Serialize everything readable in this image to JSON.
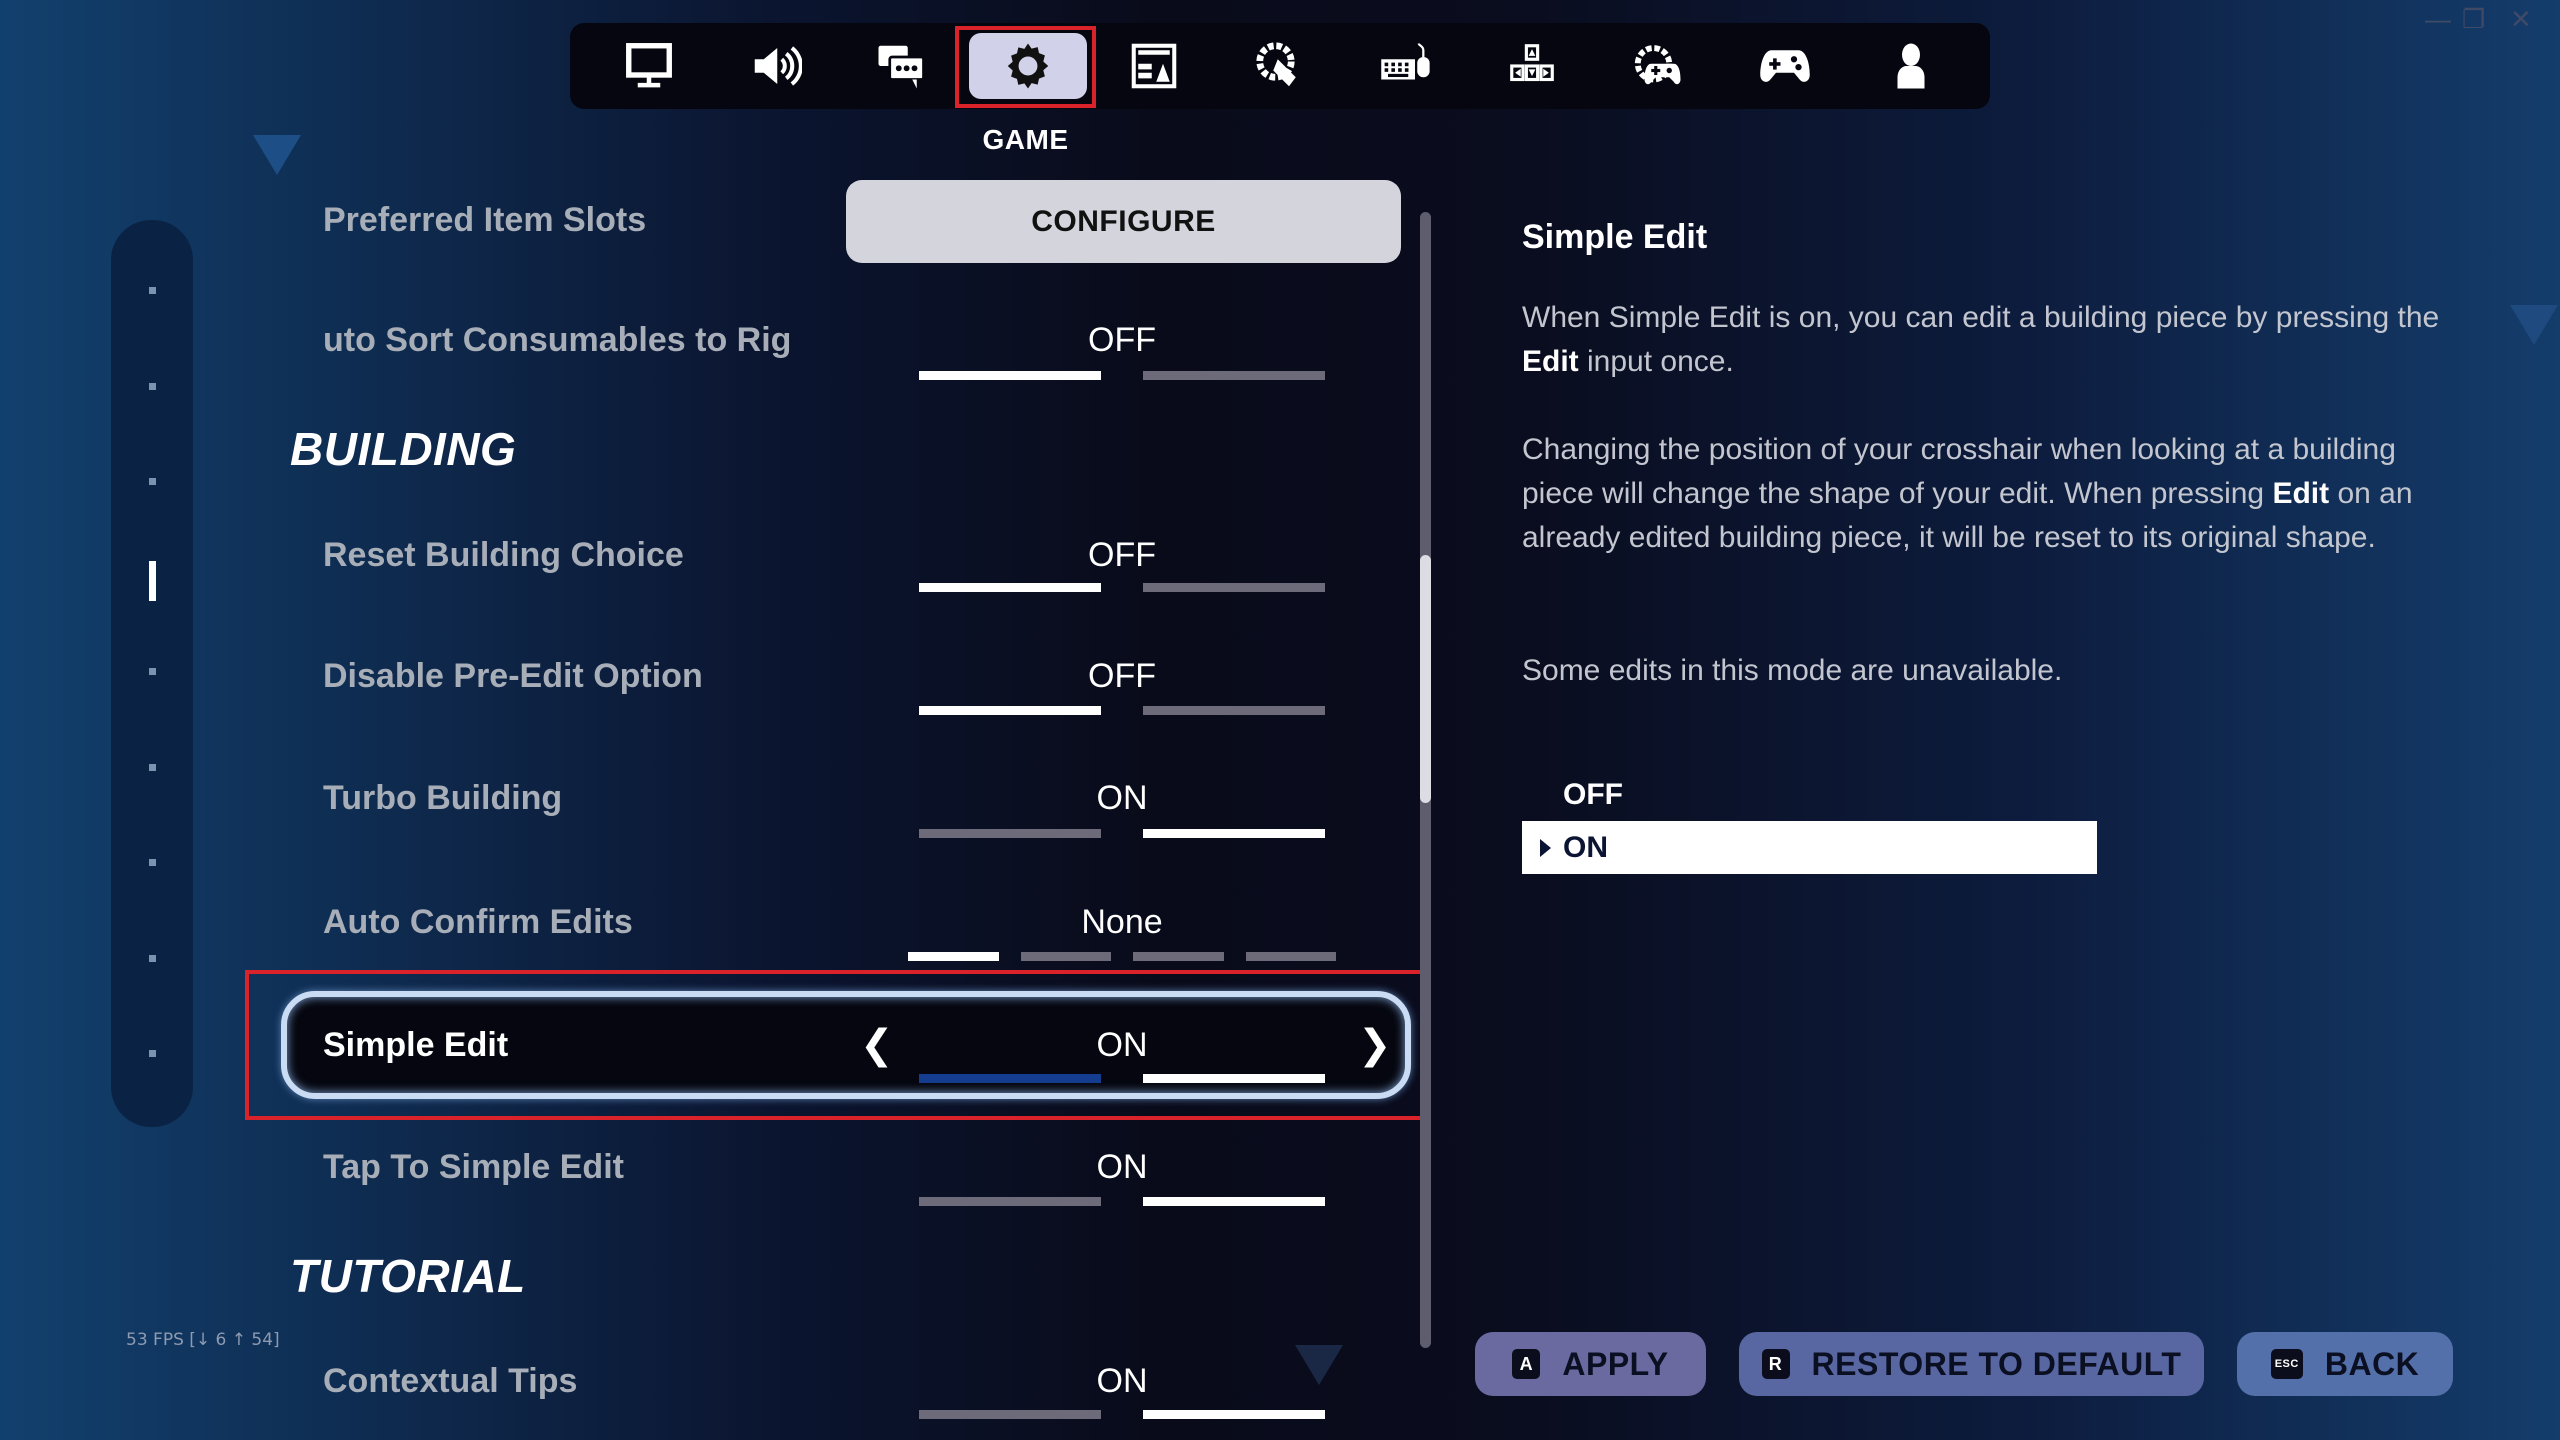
{
  "window_controls": {
    "minimize": "—",
    "restore": "❐",
    "close": "✕"
  },
  "tabs": [
    {
      "name": "display",
      "icon": "monitor-icon",
      "active": false
    },
    {
      "name": "audio",
      "icon": "speaker-icon",
      "active": false
    },
    {
      "name": "social",
      "icon": "chat-bubbles-icon",
      "active": false
    },
    {
      "name": "game",
      "icon": "gear-icon",
      "active": true
    },
    {
      "name": "ui",
      "icon": "layout-icon",
      "active": false
    },
    {
      "name": "touch",
      "icon": "gear-touch-icon",
      "active": false
    },
    {
      "name": "keyboard-mouse",
      "icon": "keyboard-mouse-icon",
      "active": false
    },
    {
      "name": "keybinds",
      "icon": "arrow-keys-icon",
      "active": false
    },
    {
      "name": "controller-settings",
      "icon": "gear-controller-icon",
      "active": false
    },
    {
      "name": "controller",
      "icon": "gamepad-icon",
      "active": false
    },
    {
      "name": "account",
      "icon": "user-icon",
      "active": false
    }
  ],
  "active_tab_label": "GAME",
  "scroll_progress_marker": 4,
  "rows": {
    "preferred_item_slots": {
      "label": "Preferred Item Slots",
      "button": "CONFIGURE"
    },
    "auto_sort": {
      "label": "uto Sort Consumables to Rig",
      "value": "OFF",
      "options": [
        "OFF",
        "ON"
      ],
      "selected_index": 0
    },
    "section_building": "BUILDING",
    "reset_building_choice": {
      "label": "Reset Building Choice",
      "value": "OFF",
      "options": [
        "OFF",
        "ON"
      ],
      "selected_index": 0
    },
    "disable_pre_edit": {
      "label": "Disable Pre-Edit Option",
      "value": "OFF",
      "options": [
        "OFF",
        "ON"
      ],
      "selected_index": 0
    },
    "turbo_building": {
      "label": "Turbo Building",
      "value": "ON",
      "options": [
        "OFF",
        "ON"
      ],
      "selected_index": 1
    },
    "auto_confirm_edits": {
      "label": "Auto Confirm Edits",
      "value": "None",
      "option_count": 4,
      "selected_index": 0
    },
    "simple_edit": {
      "label": "Simple Edit",
      "value": "ON",
      "options": [
        "OFF",
        "ON"
      ],
      "selected_index": 1,
      "prev_arrow": "❮",
      "next_arrow": "❯"
    },
    "tap_to_simple_edit": {
      "label": "Tap To Simple Edit",
      "value": "ON",
      "options": [
        "OFF",
        "ON"
      ],
      "selected_index": 1
    },
    "section_tutorial": "TUTORIAL",
    "contextual_tips": {
      "label": "Contextual Tips",
      "value": "ON",
      "options": [
        "OFF",
        "ON"
      ],
      "selected_index": 1
    }
  },
  "fps_overlay": "53 FPS [↓ 6 ↑ 54]",
  "description": {
    "title": "Simple Edit",
    "p1_a": "When Simple Edit is on, you can edit a building piece by pressing the ",
    "p1_bold": "Edit",
    "p1_b": " input once.",
    "p2_a": "Changing the position of your crosshair when looking at a building piece will change the shape of your edit. When pressing ",
    "p2_bold": "Edit",
    "p2_b": " on an already edited building piece, it will be reset to its original shape.",
    "p3": "Some edits in this mode are unavailable.",
    "options": [
      "OFF",
      "ON"
    ],
    "selected_option": "ON"
  },
  "footer": {
    "apply": {
      "key": "A",
      "label": "APPLY"
    },
    "restore": {
      "key": "R",
      "label": "RESTORE TO DEFAULT"
    },
    "back": {
      "key": "ESC",
      "label": "BACK"
    }
  },
  "colors": {
    "highlight_red": "#d9222a",
    "active_tab_bg": "#d2d1ea",
    "bar_on": "#ffffff",
    "bar_off": "#6d6b7a",
    "bar_focus": "#153d8f"
  }
}
